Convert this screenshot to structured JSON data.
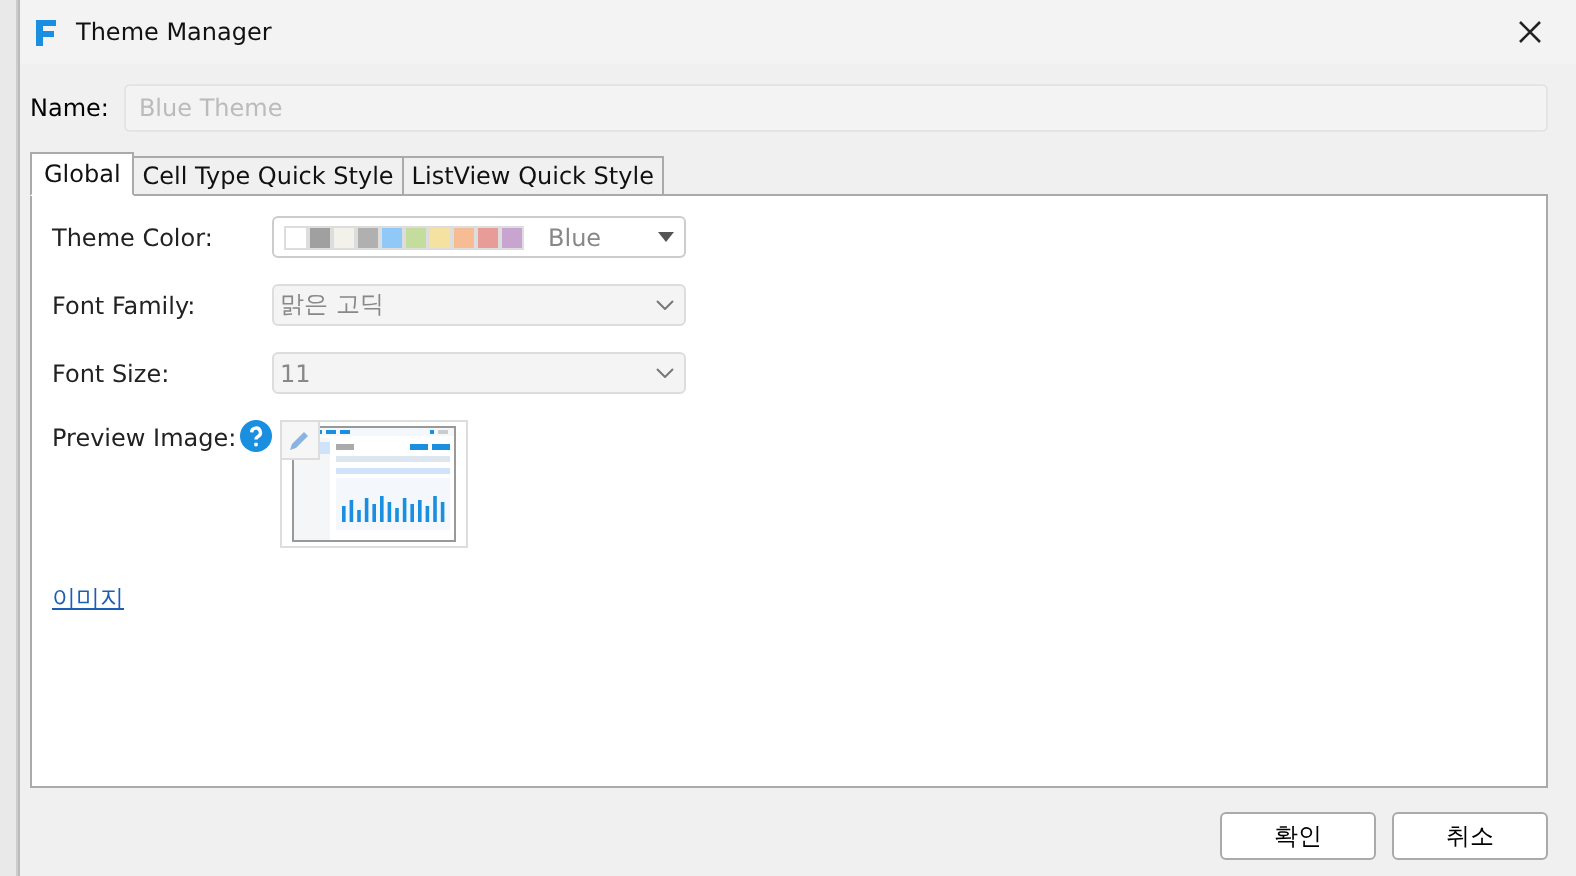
{
  "window": {
    "title": "Theme Manager"
  },
  "name_field": {
    "label": "Name:",
    "placeholder": "Blue Theme",
    "disabled": true
  },
  "tabs": [
    {
      "label": "Global",
      "selected": true
    },
    {
      "label": "Cell Type Quick Style",
      "selected": false
    },
    {
      "label": "ListView Quick Style",
      "selected": false
    }
  ],
  "theme_color": {
    "label": "Theme Color:",
    "value": "Blue",
    "disabled": false,
    "swatches": [
      {
        "color": "#ffffff"
      },
      {
        "color": "#a0a0a0"
      },
      {
        "color": "#f2f2ea"
      },
      {
        "color": "#b0b0b0"
      },
      {
        "color": "#90c8f8"
      },
      {
        "color": "#c4dc9c"
      },
      {
        "color": "#f6e2a0"
      },
      {
        "color": "#f6bc94"
      },
      {
        "color": "#e89c98"
      },
      {
        "color": "#c8a4d0"
      }
    ]
  },
  "font_family": {
    "label": "Font Family:",
    "value": "맑은 고딕",
    "disabled": true
  },
  "font_size": {
    "label": "Font Size:",
    "value": "11",
    "disabled": true
  },
  "preview_image": {
    "label": "Preview Image:"
  },
  "image_link": "이미지",
  "buttons": [
    "확인",
    "취소"
  ]
}
